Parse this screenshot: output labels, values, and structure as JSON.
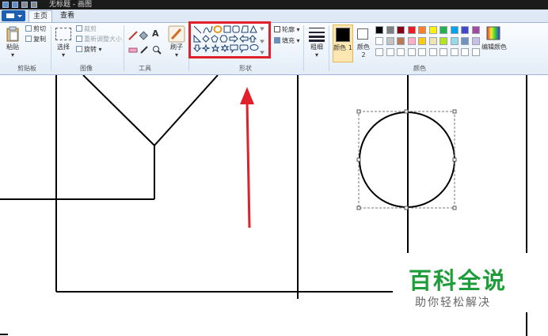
{
  "window": {
    "title": "无标题 - 画图"
  },
  "tabs": [
    {
      "label": "主页",
      "active": true
    },
    {
      "label": "查看",
      "active": false
    }
  ],
  "clipboard": {
    "paste": "粘贴",
    "cut": "剪切",
    "copy": "复制",
    "group": "剪贴板"
  },
  "image": {
    "select": "选择",
    "crop": "裁剪",
    "resize": "重新调整大小",
    "rotate": "旋转",
    "group": "图像"
  },
  "tools": {
    "group": "工具"
  },
  "brushes": {
    "label": "刷子"
  },
  "shapes": {
    "outline": "轮廓",
    "fill": "填充",
    "group": "形状"
  },
  "size": {
    "label": "粗细"
  },
  "colors": {
    "color1": "颜色 1",
    "color2": "颜色 2",
    "edit": "编辑颜色",
    "group": "颜色",
    "color1_value": "#000000",
    "color2_value": "#ffffff",
    "palette_row1": [
      "#000000",
      "#7f7f7f",
      "#880015",
      "#ed1c24",
      "#ff7f27",
      "#fff200",
      "#22b14c",
      "#00a2e8",
      "#3f48cc",
      "#a349a4"
    ],
    "palette_row2": [
      "#ffffff",
      "#c3c3c3",
      "#b97a57",
      "#ffaec9",
      "#ffc90e",
      "#efe4b0",
      "#b5e61d",
      "#99d9ea",
      "#7092be",
      "#c8bfe7"
    ]
  },
  "annotation": {
    "highlight_color": "#e0202a"
  },
  "watermark": {
    "title": "百科全说",
    "subtitle": "助你轻松解决",
    "title_color": "#1f9d3a"
  }
}
